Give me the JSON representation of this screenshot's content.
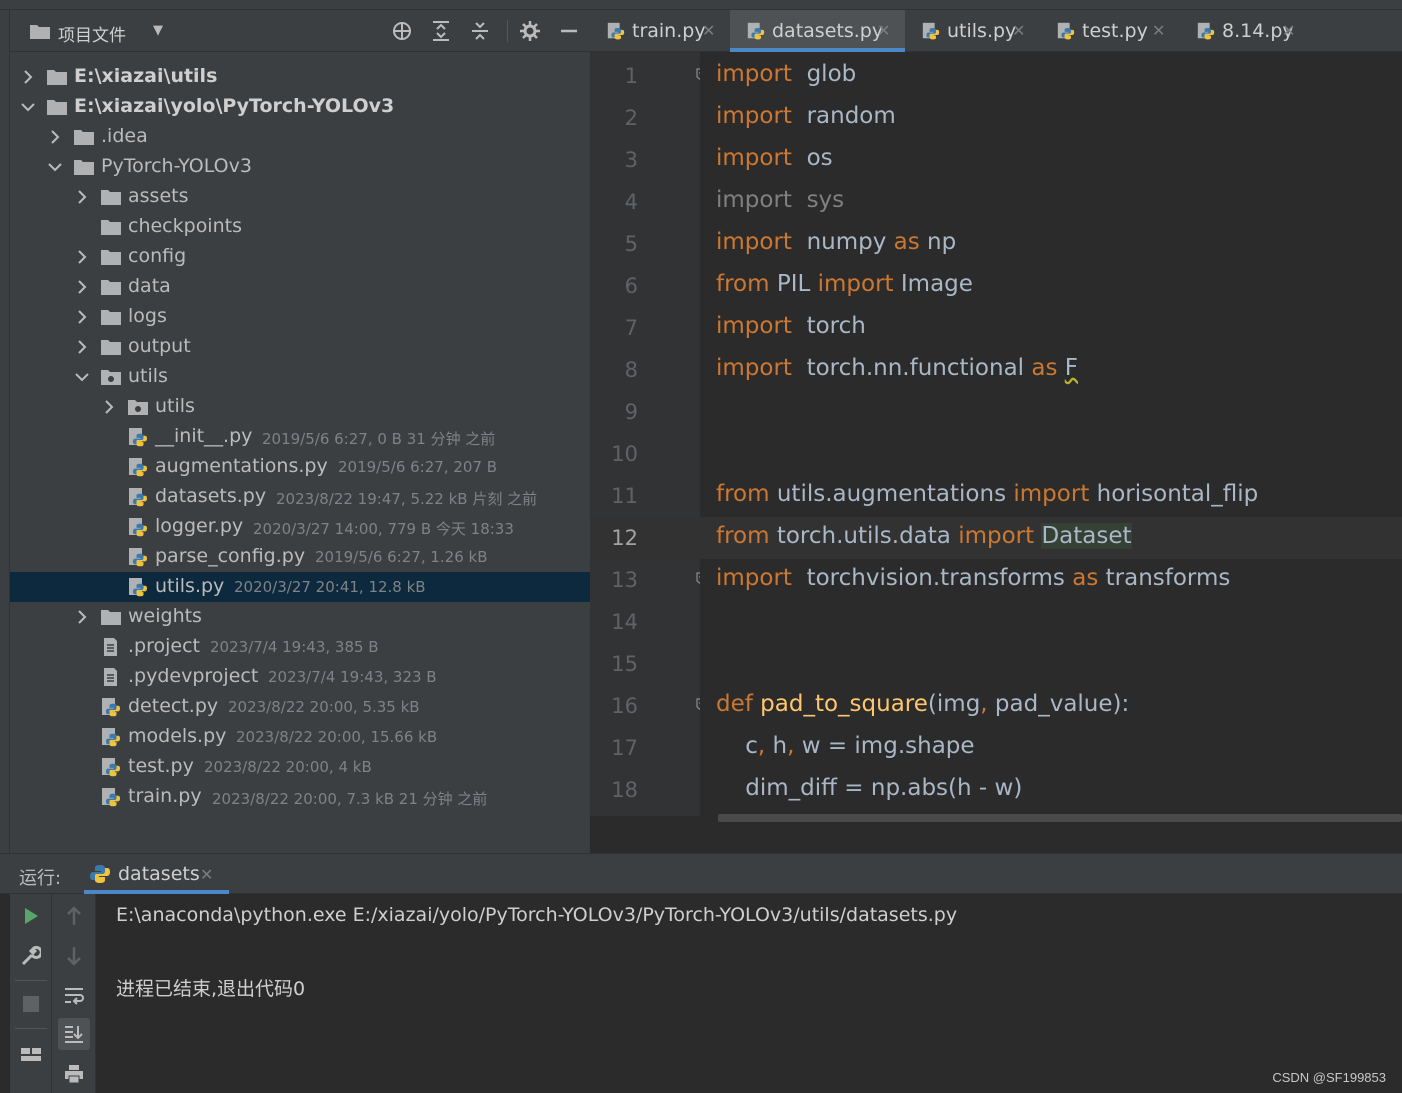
{
  "project_panel": {
    "title": "项目文件",
    "dropdown_glyph": "▼",
    "toolbar_icons": [
      "locate-icon",
      "expand-all-icon",
      "collapse-all-icon",
      "gear-icon",
      "hide-icon"
    ],
    "tree": [
      {
        "label": "E:\\xiazai\\utils",
        "meta": "",
        "type": "root-folder",
        "chevron": "right",
        "depth": 0,
        "bold": true
      },
      {
        "label": "E:\\xiazai\\yolo\\PyTorch-YOLOv3",
        "meta": "",
        "type": "root-folder",
        "chevron": "down",
        "depth": 0,
        "bold": true
      },
      {
        "label": ".idea",
        "meta": "",
        "type": "folder",
        "chevron": "right",
        "depth": 1
      },
      {
        "label": "PyTorch-YOLOv3",
        "meta": "",
        "type": "folder",
        "chevron": "down",
        "depth": 1
      },
      {
        "label": "assets",
        "meta": "",
        "type": "folder",
        "chevron": "right",
        "depth": 2
      },
      {
        "label": "checkpoints",
        "meta": "",
        "type": "folder",
        "chevron": "none",
        "depth": 2
      },
      {
        "label": "config",
        "meta": "",
        "type": "folder",
        "chevron": "right",
        "depth": 2
      },
      {
        "label": "data",
        "meta": "",
        "type": "folder",
        "chevron": "right",
        "depth": 2
      },
      {
        "label": "logs",
        "meta": "",
        "type": "folder",
        "chevron": "right",
        "depth": 2
      },
      {
        "label": "output",
        "meta": "",
        "type": "folder",
        "chevron": "right",
        "depth": 2
      },
      {
        "label": "utils",
        "meta": "",
        "type": "package",
        "chevron": "down",
        "depth": 2
      },
      {
        "label": "utils",
        "meta": "",
        "type": "package",
        "chevron": "right",
        "depth": 3
      },
      {
        "label": "__init__.py",
        "meta": "2019/5/6 6:27, 0 B 31 分钟 之前",
        "type": "python",
        "chevron": "none",
        "depth": 3
      },
      {
        "label": "augmentations.py",
        "meta": "2019/5/6 6:27, 207 B",
        "type": "python",
        "chevron": "none",
        "depth": 3
      },
      {
        "label": "datasets.py",
        "meta": "2023/8/22 19:47, 5.22 kB 片刻 之前",
        "type": "python",
        "chevron": "none",
        "depth": 3
      },
      {
        "label": "logger.py",
        "meta": "2020/3/27 14:00, 779 B 今天 18:33",
        "type": "python",
        "chevron": "none",
        "depth": 3
      },
      {
        "label": "parse_config.py",
        "meta": "2019/5/6 6:27, 1.26 kB",
        "type": "python",
        "chevron": "none",
        "depth": 3
      },
      {
        "label": "utils.py",
        "meta": "2020/3/27 20:41, 12.8 kB",
        "type": "python",
        "chevron": "none",
        "depth": 3,
        "selected": true
      },
      {
        "label": "weights",
        "meta": "",
        "type": "folder",
        "chevron": "right",
        "depth": 2
      },
      {
        "label": ".project",
        "meta": "2023/7/4 19:43, 385 B",
        "type": "text",
        "chevron": "none",
        "depth": 2
      },
      {
        "label": ".pydevproject",
        "meta": "2023/7/4 19:43, 323 B",
        "type": "text",
        "chevron": "none",
        "depth": 2
      },
      {
        "label": "detect.py",
        "meta": "2023/8/22 20:00, 5.35 kB",
        "type": "python",
        "chevron": "none",
        "depth": 2
      },
      {
        "label": "models.py",
        "meta": "2023/8/22 20:00, 15.66 kB",
        "type": "python",
        "chevron": "none",
        "depth": 2
      },
      {
        "label": "test.py",
        "meta": "2023/8/22 20:00, 4 kB",
        "type": "python",
        "chevron": "none",
        "depth": 2
      },
      {
        "label": "train.py",
        "meta": "2023/8/22 20:00, 7.3 kB 21 分钟 之前",
        "type": "python",
        "chevron": "none",
        "depth": 2
      }
    ]
  },
  "editor": {
    "close_glyph": "✕",
    "tabs": [
      {
        "label": "train.py",
        "active": false
      },
      {
        "label": "datasets.py",
        "active": true
      },
      {
        "label": "utils.py",
        "active": false
      },
      {
        "label": "test.py",
        "active": false
      },
      {
        "label": "8.14.py",
        "active": false
      }
    ],
    "current_line": 12,
    "lines": [
      {
        "n": "1",
        "tokens": [
          [
            "kw",
            "import"
          ],
          [
            "",
            "  glob"
          ]
        ],
        "fold": true
      },
      {
        "n": "2",
        "tokens": [
          [
            "kw",
            "import"
          ],
          [
            "",
            "  random"
          ]
        ]
      },
      {
        "n": "3",
        "tokens": [
          [
            "kw",
            "import"
          ],
          [
            "",
            "  os"
          ]
        ]
      },
      {
        "n": "4",
        "tokens": [
          [
            "dim",
            "import  sys"
          ]
        ]
      },
      {
        "n": "5",
        "tokens": [
          [
            "kw",
            "import"
          ],
          [
            "",
            "  numpy "
          ],
          [
            "kw",
            "as"
          ],
          [
            "",
            " np"
          ]
        ]
      },
      {
        "n": "6",
        "tokens": [
          [
            "kw",
            "from"
          ],
          [
            "",
            " PIL "
          ],
          [
            "kw",
            "import"
          ],
          [
            "",
            " Image"
          ]
        ]
      },
      {
        "n": "7",
        "tokens": [
          [
            "kw",
            "import"
          ],
          [
            "",
            "  torch"
          ]
        ]
      },
      {
        "n": "8",
        "tokens": [
          [
            "kw",
            "import"
          ],
          [
            "",
            "  torch.nn.functional "
          ],
          [
            "kw",
            "as"
          ],
          [
            "",
            " "
          ],
          [
            "squig",
            "F"
          ]
        ]
      },
      {
        "n": "9",
        "tokens": []
      },
      {
        "n": "10",
        "tokens": []
      },
      {
        "n": "11",
        "tokens": [
          [
            "kw",
            "from"
          ],
          [
            "",
            " utils.augmentations "
          ],
          [
            "kw",
            "import"
          ],
          [
            "",
            " horisontal_flip"
          ]
        ]
      },
      {
        "n": "12",
        "tokens": [
          [
            "kw",
            "from"
          ],
          [
            "",
            " torch.utils.data "
          ],
          [
            "kw",
            "import"
          ],
          [
            "",
            " "
          ],
          [
            "hl",
            "Dataset"
          ]
        ]
      },
      {
        "n": "13",
        "tokens": [
          [
            "kw",
            "import"
          ],
          [
            "",
            "  torchvision.transforms "
          ],
          [
            "kw",
            "as"
          ],
          [
            "",
            " transforms"
          ]
        ],
        "fold": true
      },
      {
        "n": "14",
        "tokens": []
      },
      {
        "n": "15",
        "tokens": []
      },
      {
        "n": "16",
        "tokens": [
          [
            "kw",
            "def"
          ],
          [
            "",
            " "
          ],
          [
            "fn",
            "pad_to_square"
          ],
          [
            "",
            "(img"
          ],
          [
            "kw",
            ","
          ],
          [
            "",
            " pad_value):"
          ]
        ],
        "fold": true
      },
      {
        "n": "17",
        "tokens": [
          [
            "",
            "    c"
          ],
          [
            "kw",
            ","
          ],
          [
            "",
            " h"
          ],
          [
            "kw",
            ","
          ],
          [
            "",
            " w = img.shape"
          ]
        ]
      },
      {
        "n": "18",
        "tokens": [
          [
            "",
            "    dim_diff = np.abs(h - w)"
          ]
        ]
      }
    ]
  },
  "run_panel": {
    "label": "运行:",
    "tab_label": "datasets",
    "tool_icons_left": [
      "run-icon",
      "wrench-icon",
      "stop-icon",
      "layout-icon"
    ],
    "tool_icons_right": [
      "up-arrow-icon",
      "down-arrow-icon",
      "soft-wrap-icon",
      "scroll-to-end-icon",
      "print-icon"
    ],
    "output": [
      "E:\\anaconda\\python.exe E:/xiazai/yolo/PyTorch-YOLOv3/PyTorch-YOLOv3/utils/datasets.py",
      "",
      "进程已结束,退出代码0"
    ]
  },
  "watermark": "CSDN @SF199853",
  "colors": {
    "keyword": "#cc7832",
    "function_def": "#ffc66d",
    "text": "#a9b7c6",
    "selection": "#0d293e",
    "accent": "#4a88c7",
    "folder": "#afb1b3",
    "python_blue": "#3c78aa",
    "python_yellow": "#f0c33c"
  }
}
